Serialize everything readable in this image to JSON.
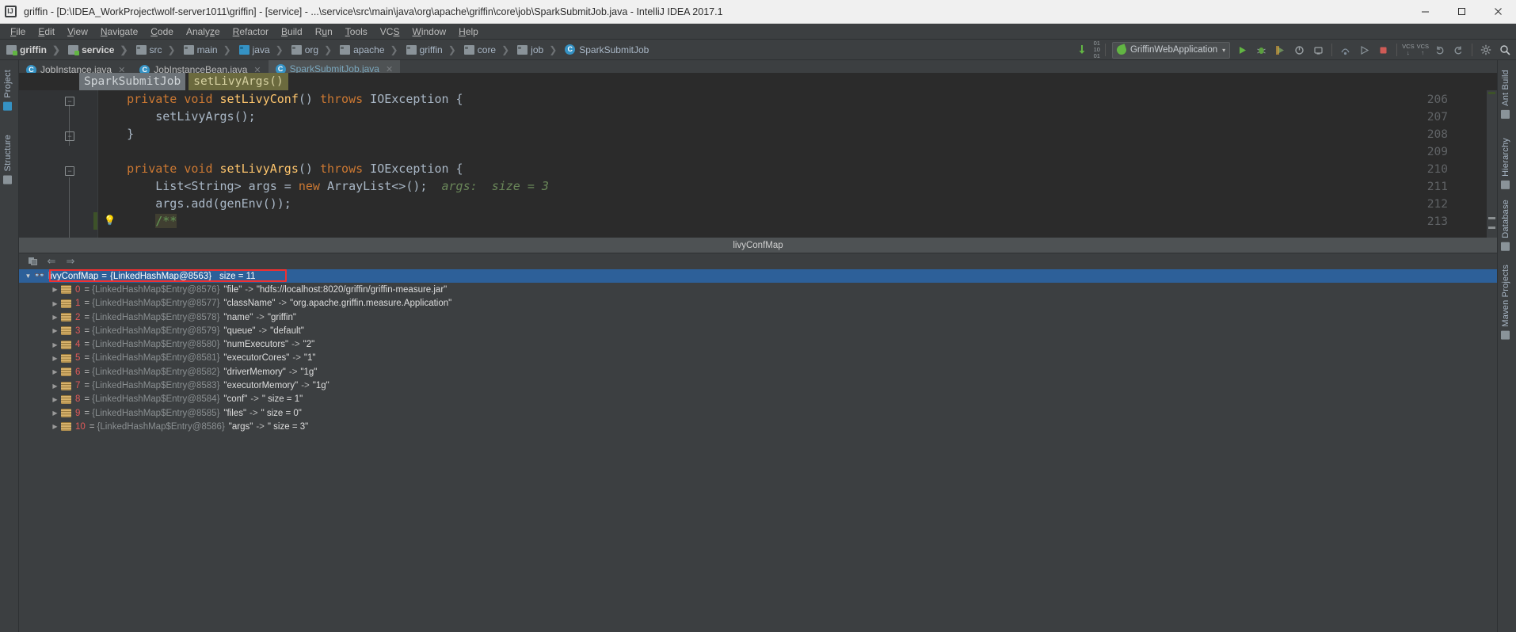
{
  "titlebar": {
    "title": "griffin - [D:\\IDEA_WorkProject\\wolf-server1011\\griffin] - [service] - ...\\service\\src\\main\\java\\org\\apache\\griffin\\core\\job\\SparkSubmitJob.java - IntelliJ IDEA 2017.1",
    "app_icon": "intellij-idea-icon",
    "minimize_label": "–",
    "maximize_label": "☐",
    "close_label": "✕"
  },
  "menubar": {
    "items": [
      {
        "label": "File",
        "mnemonic": "F"
      },
      {
        "label": "Edit",
        "mnemonic": "E"
      },
      {
        "label": "View",
        "mnemonic": "V"
      },
      {
        "label": "Navigate",
        "mnemonic": "N"
      },
      {
        "label": "Code",
        "mnemonic": "C"
      },
      {
        "label": "Analyze",
        "mnemonic": "z"
      },
      {
        "label": "Refactor",
        "mnemonic": "R"
      },
      {
        "label": "Build",
        "mnemonic": "B"
      },
      {
        "label": "Run",
        "mnemonic": "R"
      },
      {
        "label": "Tools",
        "mnemonic": "T"
      },
      {
        "label": "VCS",
        "mnemonic": "S"
      },
      {
        "label": "Window",
        "mnemonic": "W"
      },
      {
        "label": "Help",
        "mnemonic": "H"
      }
    ]
  },
  "navbar": {
    "crumbs": [
      {
        "label": "griffin",
        "icon": "module-icon",
        "bold": true
      },
      {
        "label": "service",
        "icon": "module-icon",
        "bold": true
      },
      {
        "label": "src",
        "icon": "folder-icon",
        "bold": false
      },
      {
        "label": "main",
        "icon": "folder-icon",
        "bold": false
      },
      {
        "label": "java",
        "icon": "source-folder-icon",
        "bold": false
      },
      {
        "label": "org",
        "icon": "package-icon",
        "bold": false
      },
      {
        "label": "apache",
        "icon": "package-icon",
        "bold": false
      },
      {
        "label": "griffin",
        "icon": "package-icon",
        "bold": false
      },
      {
        "label": "core",
        "icon": "package-icon",
        "bold": false
      },
      {
        "label": "job",
        "icon": "package-icon",
        "bold": false
      },
      {
        "label": "SparkSubmitJob",
        "icon": "java-class-icon",
        "bold": false
      }
    ],
    "run_config": {
      "name": "GriffinWebApplication",
      "icon": "spring-boot-icon",
      "dropdown": "▾"
    },
    "buttons": [
      {
        "name": "update-project-button",
        "glyph": "⬇"
      },
      {
        "name": "run-button",
        "glyph": "▶"
      },
      {
        "name": "debug-button",
        "glyph": "🐞"
      },
      {
        "name": "run-coverage-button",
        "glyph": "◩"
      },
      {
        "name": "profile-button",
        "glyph": "◴"
      },
      {
        "name": "attach-process-button",
        "glyph": "⎘"
      },
      {
        "name": "step-over-button",
        "glyph": "⤷"
      },
      {
        "name": "resume-program-button",
        "glyph": "▷"
      },
      {
        "name": "stop-button",
        "glyph": "■"
      },
      {
        "name": "vcs-update-button",
        "glyph": "VCS"
      },
      {
        "name": "vcs-commit-button",
        "glyph": "VCS"
      },
      {
        "name": "undo-button",
        "glyph": "↶"
      },
      {
        "name": "redo-button",
        "glyph": "↷"
      },
      {
        "name": "settings-button",
        "glyph": "⚙"
      },
      {
        "name": "search-everywhere-button",
        "glyph": "🔍"
      }
    ]
  },
  "tabs": [
    {
      "label": "JobInstance.java",
      "icon": "java-class-icon",
      "active": false,
      "close": "✕"
    },
    {
      "label": "JobInstanceBean.java",
      "icon": "java-class-icon",
      "active": false,
      "close": "✕"
    },
    {
      "label": "SparkSubmitJob.java",
      "icon": "java-class-icon",
      "active": true,
      "close": "✕"
    }
  ],
  "left_tool_window_tabs": [
    {
      "label": "Project",
      "icon": "project-tree-icon"
    },
    {
      "label": "Structure",
      "icon": "structure-icon"
    }
  ],
  "right_tool_window_tabs": [
    {
      "label": "Ant Build",
      "icon": "ant-icon"
    },
    {
      "label": "Hierarchy",
      "icon": "hierarchy-icon"
    },
    {
      "label": "Database",
      "icon": "database-icon"
    },
    {
      "label": "Maven Projects",
      "icon": "maven-icon"
    }
  ],
  "editor": {
    "breadcrumb": {
      "class": "SparkSubmitJob",
      "method": "setLivyArgs()"
    },
    "lines": [
      {
        "num": "206",
        "fold": "−",
        "segments": [
          {
            "t": "    ",
            "c": "plain"
          },
          {
            "t": "private",
            "c": "kw"
          },
          {
            "t": " ",
            "c": "plain"
          },
          {
            "t": "void",
            "c": "kw"
          },
          {
            "t": " ",
            "c": "plain"
          },
          {
            "t": "setLivyConf",
            "c": "mn"
          },
          {
            "t": "() ",
            "c": "plain"
          },
          {
            "t": "throws",
            "c": "kw"
          },
          {
            "t": " IOException {",
            "c": "plain"
          }
        ]
      },
      {
        "num": "207",
        "fold": "",
        "segments": [
          {
            "t": "        setLivyArgs();",
            "c": "plain"
          }
        ]
      },
      {
        "num": "208",
        "fold": "−",
        "segments": [
          {
            "t": "    }",
            "c": "plain"
          }
        ]
      },
      {
        "num": "209",
        "fold": "",
        "segments": []
      },
      {
        "num": "210",
        "fold": "−",
        "segments": [
          {
            "t": "    ",
            "c": "plain"
          },
          {
            "t": "private",
            "c": "kw"
          },
          {
            "t": " ",
            "c": "plain"
          },
          {
            "t": "void",
            "c": "kw"
          },
          {
            "t": " ",
            "c": "plain"
          },
          {
            "t": "setLivyArgs",
            "c": "mn"
          },
          {
            "t": "() ",
            "c": "plain"
          },
          {
            "t": "throws",
            "c": "kw"
          },
          {
            "t": " IOException {",
            "c": "plain"
          }
        ]
      },
      {
        "num": "211",
        "fold": "",
        "segments": [
          {
            "t": "        List<String> args = ",
            "c": "plain"
          },
          {
            "t": "new",
            "c": "kw"
          },
          {
            "t": " ArrayList<>();  ",
            "c": "plain"
          },
          {
            "t": "args:  size = 3",
            "c": "hint"
          }
        ]
      },
      {
        "num": "212",
        "fold": "",
        "segments": [
          {
            "t": "        args.add(genEnv());",
            "c": "plain"
          }
        ]
      },
      {
        "num": "213",
        "fold": "",
        "bulb": "💡",
        "modified": true,
        "segments": [
          {
            "t": "        ",
            "c": "plain"
          },
          {
            "t": "/**",
            "c": "cmt"
          }
        ]
      }
    ]
  },
  "debugger": {
    "panel_title": "livyConfMap",
    "toolbar": [
      {
        "name": "copy-value-button",
        "glyph": "⧉"
      },
      {
        "name": "back-button",
        "glyph": "⇐"
      },
      {
        "name": "forward-button",
        "glyph": "⇒"
      }
    ],
    "root": {
      "arrow": "▼",
      "icon": "watch-glasses-icon",
      "name": "livyConfMap",
      "eq": "=",
      "ref": "{LinkedHashMap@8563}",
      "size_label": "size = 11",
      "selected": true,
      "highlight_color": "#f03030"
    },
    "entries": [
      {
        "arrow": "▶",
        "index": "0",
        "ref": "{LinkedHashMap$Entry@8576}",
        "key": "\"file\"",
        "arrow_op": "->",
        "value": "\"hdfs://localhost:8020/griffin/griffin-measure.jar\""
      },
      {
        "arrow": "▶",
        "index": "1",
        "ref": "{LinkedHashMap$Entry@8577}",
        "key": "\"className\"",
        "arrow_op": "->",
        "value": "\"org.apache.griffin.measure.Application\""
      },
      {
        "arrow": "▶",
        "index": "2",
        "ref": "{LinkedHashMap$Entry@8578}",
        "key": "\"name\"",
        "arrow_op": "->",
        "value": "\"griffin\""
      },
      {
        "arrow": "▶",
        "index": "3",
        "ref": "{LinkedHashMap$Entry@8579}",
        "key": "\"queue\"",
        "arrow_op": "->",
        "value": "\"default\""
      },
      {
        "arrow": "▶",
        "index": "4",
        "ref": "{LinkedHashMap$Entry@8580}",
        "key": "\"numExecutors\"",
        "arrow_op": "->",
        "value": "\"2\""
      },
      {
        "arrow": "▶",
        "index": "5",
        "ref": "{LinkedHashMap$Entry@8581}",
        "key": "\"executorCores\"",
        "arrow_op": "->",
        "value": "\"1\""
      },
      {
        "arrow": "▶",
        "index": "6",
        "ref": "{LinkedHashMap$Entry@8582}",
        "key": "\"driverMemory\"",
        "arrow_op": "->",
        "value": "\"1g\""
      },
      {
        "arrow": "▶",
        "index": "7",
        "ref": "{LinkedHashMap$Entry@8583}",
        "key": "\"executorMemory\"",
        "arrow_op": "->",
        "value": "\"1g\""
      },
      {
        "arrow": "▶",
        "index": "8",
        "ref": "{LinkedHashMap$Entry@8584}",
        "key": "\"conf\"",
        "arrow_op": "->",
        "value": "\" size = 1\""
      },
      {
        "arrow": "▶",
        "index": "9",
        "ref": "{LinkedHashMap$Entry@8585}",
        "key": "\"files\"",
        "arrow_op": "->",
        "value": "\" size = 0\""
      },
      {
        "arrow": "▶",
        "index": "10",
        "ref": "{LinkedHashMap$Entry@8586}",
        "key": "\"args\"",
        "arrow_op": "->",
        "value": "\" size = 3\""
      }
    ]
  },
  "colors": {
    "background": "#3c3f41",
    "editor_bg": "#2b2b2b",
    "accent_selection": "#2d6099",
    "highlight_red": "#f03030",
    "keyword": "#cc7832",
    "method": "#ffc66d",
    "comment": "#629755",
    "hint": "#6a8759",
    "tab_active": "#4a88c7"
  }
}
